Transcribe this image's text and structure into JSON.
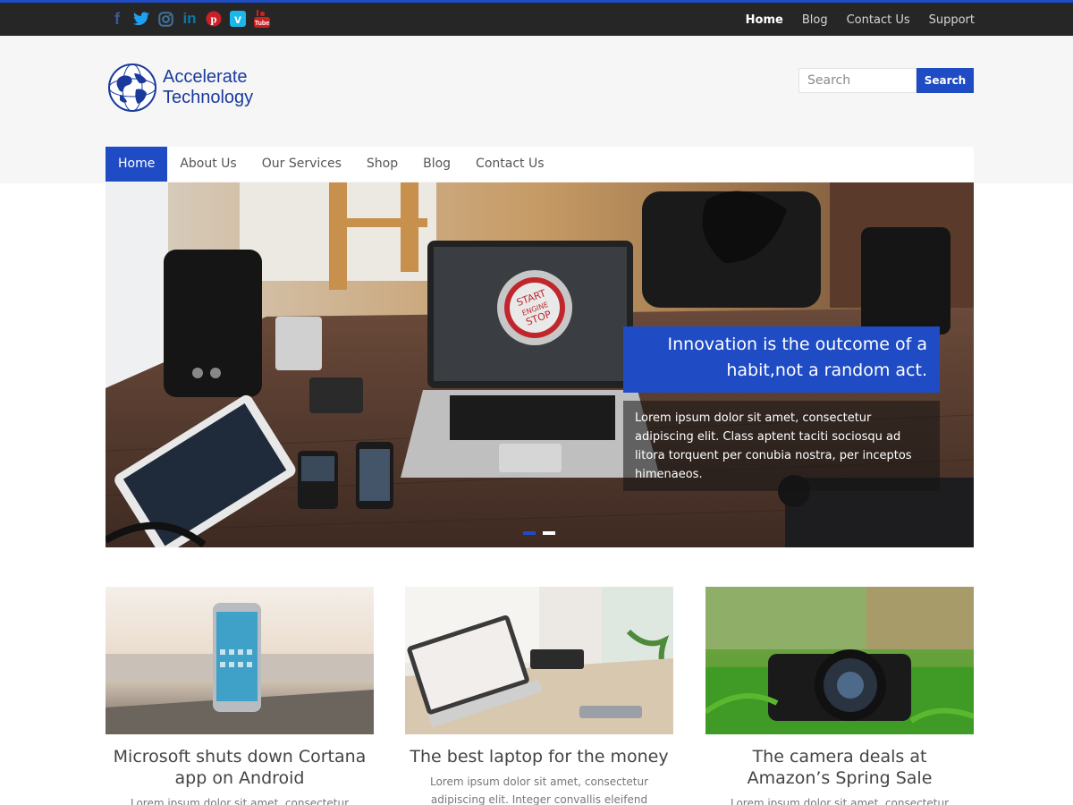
{
  "topbar": {
    "social_icons": [
      "facebook-icon",
      "twitter-icon",
      "instagram-icon",
      "linkedin-icon",
      "pinterest-icon",
      "vimeo-icon",
      "youtube-icon"
    ],
    "links": [
      "Home",
      "Blog",
      "Contact Us",
      "Support"
    ],
    "active_link": "Home"
  },
  "header": {
    "logo_line1": "Accelerate",
    "logo_line2": "Technology",
    "search_placeholder": "Search",
    "search_button": "Search"
  },
  "nav": {
    "items": [
      "Home",
      "About Us",
      "Our Services",
      "Shop",
      "Blog",
      "Contact Us"
    ],
    "active": "Home"
  },
  "hero": {
    "title_line1": "Innovation is the outcome of a",
    "title_line2": "habit,not a random act.",
    "text_line1": "Lorem ipsum dolor sit amet, consectetur",
    "text_line2": "adipiscing elit. Class aptent taciti sociosqu ad",
    "text_line3": "litora torquent per conubia nostra, per inceptos",
    "text_line4": "himenaeos.",
    "screen_line1": "START",
    "screen_line2": "ENGINE",
    "screen_line3": "STOP",
    "slide_count": 2,
    "active_slide": 1
  },
  "cards": [
    {
      "title_line1": "Microsoft shuts down Cortana",
      "title_line2": "app on Android",
      "excerpt": "Lorem ipsum dolor sit amet, consectetur"
    },
    {
      "title_line1": "The best laptop for the money",
      "title_line2": "",
      "excerpt_line1": "Lorem ipsum dolor sit amet, consectetur",
      "excerpt_line2": "adipiscing elit. Integer convallis eleifend"
    },
    {
      "title_line1": "The camera deals at",
      "title_line2": "Amazon’s Spring Sale",
      "excerpt": "Lorem ipsum dolor sit amet, consectetur"
    }
  ],
  "colors": {
    "accent": "#1f4cc4",
    "topbar_bg": "#262626",
    "header_bg": "#f6f6f6"
  }
}
